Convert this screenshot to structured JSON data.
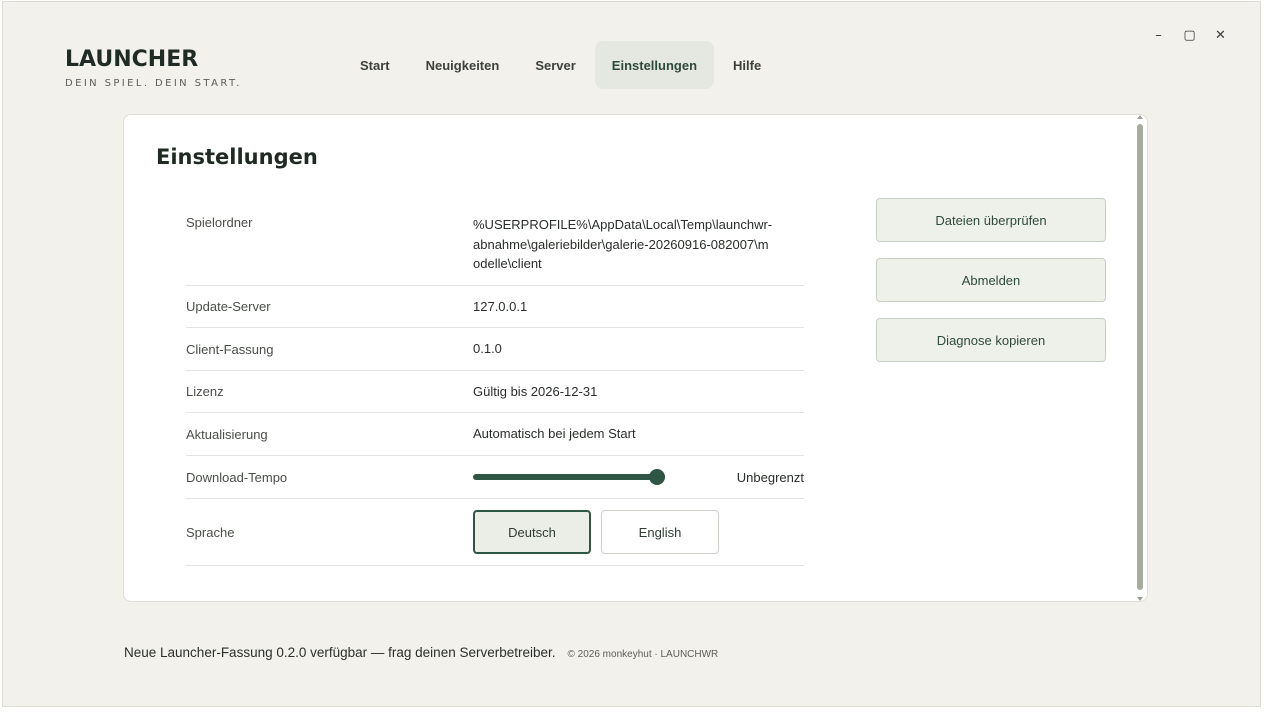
{
  "window": {
    "controls": {
      "minimize": "–",
      "maximize": "▢",
      "close": "✕"
    }
  },
  "brand": {
    "title": "LAUNCHER",
    "subtitle": "DEIN SPIEL. DEIN START."
  },
  "nav": {
    "items": [
      {
        "label": "Start"
      },
      {
        "label": "Neuigkeiten"
      },
      {
        "label": "Server"
      },
      {
        "label": "Einstellungen",
        "active": true
      },
      {
        "label": "Hilfe"
      }
    ]
  },
  "settings": {
    "title": "Einstellungen",
    "rows": {
      "folder": {
        "label": "Spielordner",
        "value": "%USERPROFILE%\\AppData\\Local\\Temp\\launchwr-abnahme\\galeriebilder\\galerie-20260916-082007\\modelle\\client"
      },
      "update_server": {
        "label": "Update-Server",
        "value": "127.0.0.1"
      },
      "client_version": {
        "label": "Client-Fassung",
        "value": "0.1.0"
      },
      "license": {
        "label": "Lizenz",
        "value": "Gültig bis 2026-12-31"
      },
      "updates": {
        "label": "Aktualisierung",
        "value": "Automatisch bei jedem Start"
      },
      "download_speed": {
        "label": "Download-Tempo",
        "value": "Unbegrenzt",
        "level_percent": 96
      },
      "language": {
        "label": "Sprache",
        "options": [
          {
            "label": "Deutsch",
            "selected": true
          },
          {
            "label": "English",
            "selected": false
          }
        ]
      }
    }
  },
  "actions": {
    "verify": "Dateien überprüfen",
    "logout": "Abmelden",
    "copy_diag": "Diagnose kopieren"
  },
  "footer": {
    "note": "Neue Launcher-Fassung 0.2.0 verfügbar — frag deinen Serverbetreiber.",
    "copyright": "© 2026 monkeyhut · LAUNCHWR"
  },
  "colors": {
    "accent": "#2f5545",
    "background": "#f2f1ec"
  }
}
